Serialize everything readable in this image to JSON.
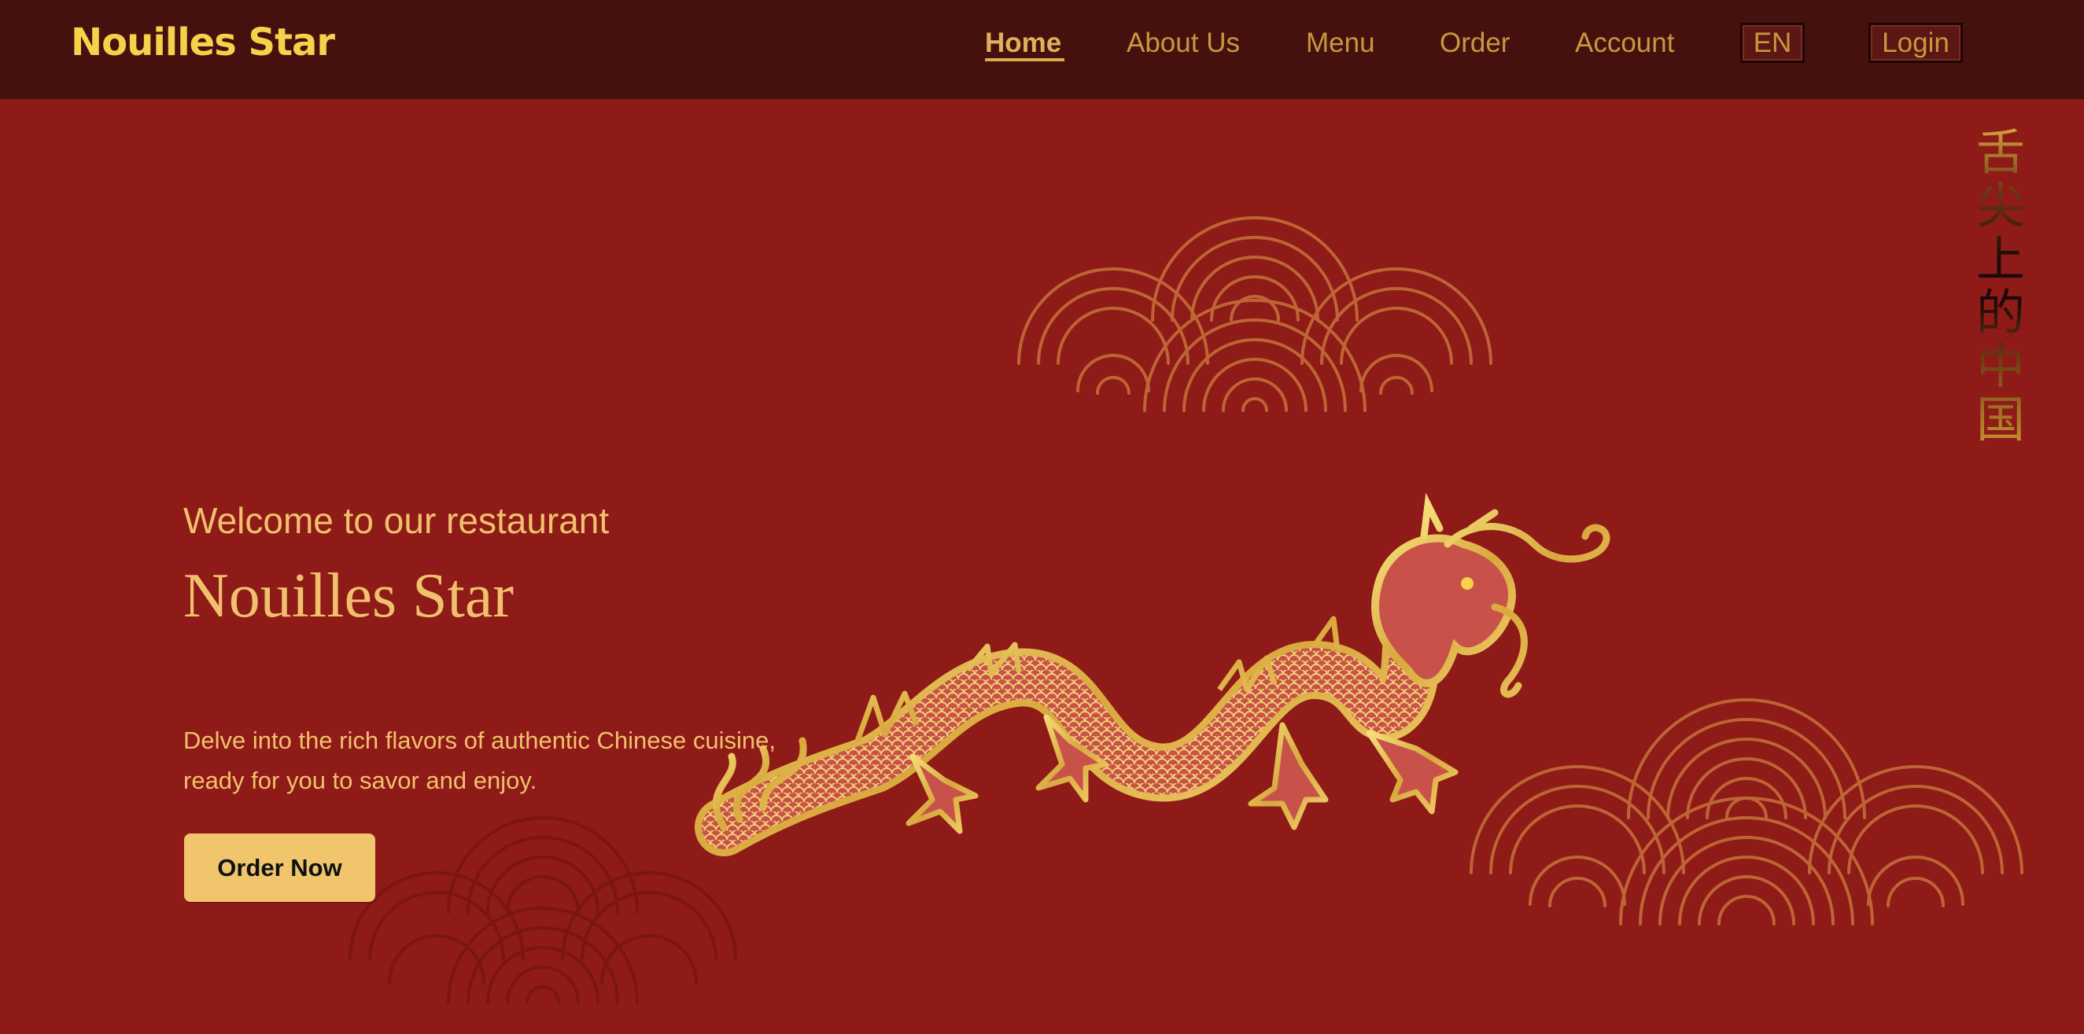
{
  "header": {
    "brand": "Nouilles Star",
    "nav": {
      "home": "Home",
      "about": "About Us",
      "menu": "Menu",
      "order": "Order",
      "account": "Account"
    },
    "language_button": "EN",
    "login_button": "Login"
  },
  "hero": {
    "welcome": "Welcome to our restaurant",
    "title": "Nouilles Star",
    "description": "Delve into the rich flavors of authentic Chinese cuisine, ready for you to savor and enjoy.",
    "cta_label": "Order Now"
  },
  "vertical_slogan": "舌尖上的中国",
  "decor": {
    "icons": [
      "cloud-pattern-icon",
      "dragon-icon"
    ]
  },
  "colors": {
    "background": "#8e1b17",
    "header": "#45110f",
    "brand": "#f6d24a",
    "nav_text": "#c9973f",
    "accent_gold": "#f0c56c"
  }
}
